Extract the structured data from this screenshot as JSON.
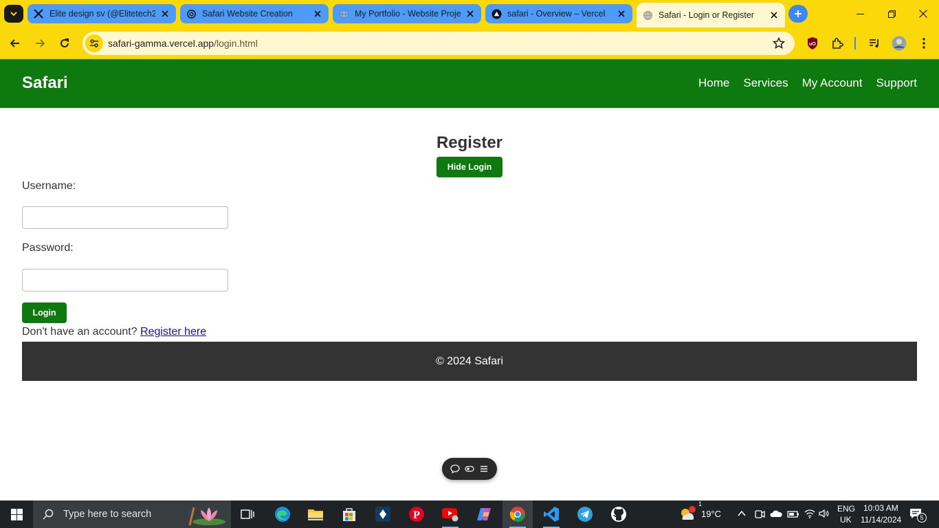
{
  "browser": {
    "tabs": [
      {
        "title": "Elite design sv (@Elitetech25",
        "favicon": "x-logo-icon",
        "active": false
      },
      {
        "title": "Safari Website Creation",
        "favicon": "chatgpt-icon",
        "active": false
      },
      {
        "title": "My Portfolio - Website Proje",
        "favicon": "globe-icon",
        "active": false
      },
      {
        "title": "safari - Overview – Vercel",
        "favicon": "vercel-icon",
        "active": false
      },
      {
        "title": "Safari - Login or Register",
        "favicon": "globe-icon",
        "active": true
      }
    ],
    "url_host": "safari-gamma.vercel.app",
    "url_path": "/login.html",
    "theme_color": "#fbd80a"
  },
  "site": {
    "logo": "Safari",
    "nav": [
      "Home",
      "Services",
      "My Account",
      "Support"
    ],
    "brand_color": "#0e790e",
    "form": {
      "title": "Register",
      "hide_login_label": "Hide Login",
      "username_label": "Username:",
      "username_value": "",
      "password_label": "Password:",
      "password_value": "",
      "login_label": "Login",
      "register_prompt": "Don't have an account?",
      "register_link": "Register here"
    },
    "footer": "© 2024 Safari"
  },
  "taskbar": {
    "search_placeholder": "Type here to search",
    "weather_temp": "19°C",
    "weather_badge": "1",
    "language": "ENG",
    "region": "UK",
    "time": "10:03 AM",
    "date": "11/14/2024",
    "notification_count": "5"
  }
}
